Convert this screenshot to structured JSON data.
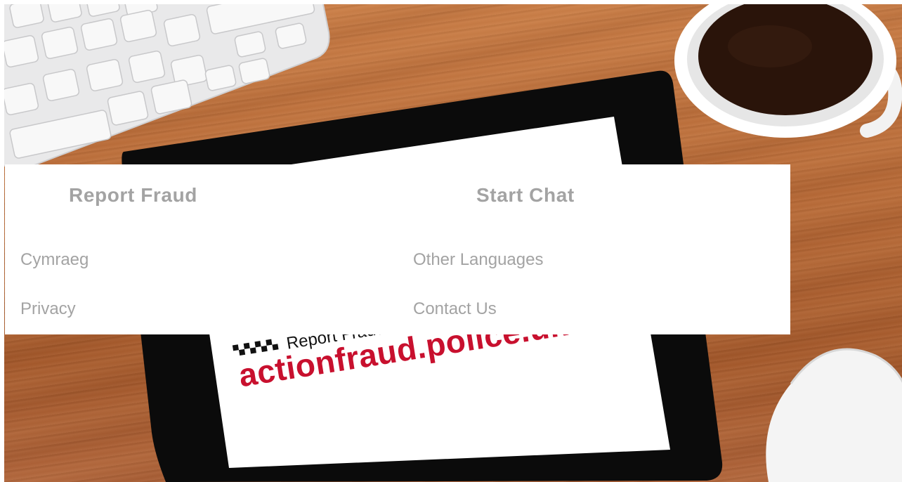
{
  "page": {
    "background_brand": {
      "tagline": "Report Fraud",
      "url": "actionfraud.police.uk",
      "url_color": "#c8102e"
    }
  },
  "menu": {
    "headings": {
      "report_fraud": "Report Fraud",
      "start_chat": "Start Chat"
    },
    "links": {
      "cymraeg": "Cymraeg",
      "other_languages": "Other Languages",
      "privacy": "Privacy",
      "contact_us": "Contact Us"
    },
    "text_color": "#a3a3a3"
  }
}
